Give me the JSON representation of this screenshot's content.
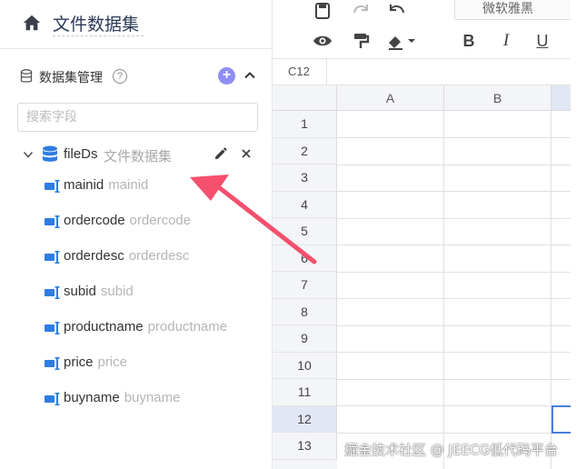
{
  "header": {
    "title": "文件数据集"
  },
  "datasets": {
    "label": "数据集管理",
    "help_glyph": "?",
    "add_glyph": "+",
    "search_placeholder": "搜索字段"
  },
  "tree": {
    "root": {
      "name": "fileDs",
      "alias": "文件数据集"
    },
    "fields": [
      {
        "name": "mainid",
        "alias": "mainid"
      },
      {
        "name": "ordercode",
        "alias": "ordercode"
      },
      {
        "name": "orderdesc",
        "alias": "orderdesc"
      },
      {
        "name": "subid",
        "alias": "subid"
      },
      {
        "name": "productname",
        "alias": "productname"
      },
      {
        "name": "price",
        "alias": "price"
      },
      {
        "name": "buyname",
        "alias": "buyname"
      }
    ]
  },
  "toolbar": {
    "font_name": "微软雅黑",
    "bold": "B",
    "italic": "I",
    "underline": "U"
  },
  "sheet": {
    "cell_ref": "C12",
    "columns": [
      "A",
      "B"
    ],
    "rows": [
      "1",
      "2",
      "3",
      "4",
      "5",
      "6",
      "7",
      "8",
      "9",
      "10",
      "11",
      "12",
      "13"
    ],
    "selected_row": "12"
  },
  "watermark": "掘金技术社区 @ JEECG低代码平台",
  "colors": {
    "accent": "#2f7de1",
    "add_button": "#8e8ef5",
    "arrow": "#f5506d",
    "selection": "#4a7ed9"
  }
}
